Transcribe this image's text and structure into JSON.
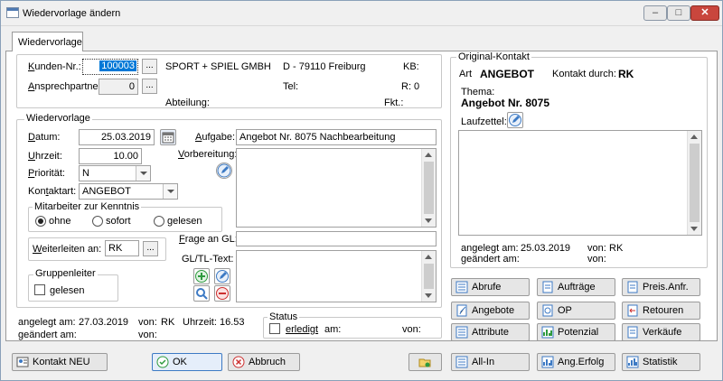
{
  "window": {
    "title": "Wiedervorlage ändern",
    "min": "–",
    "max": "□",
    "close": "✕"
  },
  "tab": "Wiedervorlage",
  "customer": {
    "kunden_label": "Kunden-Nr.:",
    "kunden_nr": "100003",
    "company": "SPORT + SPIEL GMBH",
    "address": "D - 79110 Freiburg",
    "kb_label": "KB:",
    "ansprech_label": "Ansprechpartner:",
    "ansprech_value": "0",
    "tel_label": "Tel:",
    "r_label": "R: 0",
    "abteilung_label": "Abteilung:",
    "fkt_label": "Fkt.:",
    "dots": "..."
  },
  "wv": {
    "legend": "Wiedervorlage",
    "datum_label": "Datum:",
    "datum": "25.03.2019",
    "uhrzeit_label": "Uhrzeit:",
    "uhrzeit": "10.00",
    "prioritaet_label": "Priorität:",
    "prioritaet": "N",
    "kontaktart_label": "Kontaktart:",
    "kontaktart": "ANGEBOT",
    "aufgabe_label": "Aufgabe:",
    "aufgabe": "Angebot Nr. 8075 Nachbearbeitung",
    "vorbereitung_label": "Vorbereitung:",
    "kenntnis_legend": "Mitarbeiter zur Kenntnis",
    "opt_ohne": "ohne",
    "opt_sofort": "sofort",
    "opt_gelesen": "gelesen",
    "weiterleiten_label": "Weiterleiten an:",
    "weiterleiten": "RK",
    "frage_label": "Frage an GL:",
    "gltl_label": "GL/TL-Text:",
    "gruppenleiter_legend": "Gruppenleiter",
    "gelesen_label": "gelesen"
  },
  "original": {
    "legend": "Original-Kontakt",
    "art_label": "Art",
    "art": "ANGEBOT",
    "kontakt_durch_label": "Kontakt durch:",
    "kontakt_durch": "RK",
    "thema_label": "Thema:",
    "thema": "Angebot Nr. 8075",
    "laufzettel_label": "Laufzettel:",
    "angelegt_label": "angelegt am:",
    "angelegt": "25.03.2019",
    "von_label": "von:",
    "angelegt_von": "RK",
    "geaendert_label": "geändert am:",
    "geaendert_von_label": "von:"
  },
  "footer": {
    "angelegt_label": "angelegt am:",
    "angelegt": "27.03.2019",
    "von_label": "von:",
    "von": "RK",
    "uhrzeit_label": "Uhrzeit:",
    "uhrzeit": "16.53",
    "geaendert_label": "geändert am:",
    "geaendert_von_label": "von:",
    "status_legend": "Status",
    "erledigt_label": "erledigt",
    "am_label": "am:",
    "status_von_label": "von:"
  },
  "actions": [
    "Abrufe",
    "Aufträge",
    "Preis.Anfr.",
    "Angebote",
    "OP",
    "Retouren",
    "Attribute",
    "Potenzial",
    "Verkäufe"
  ],
  "bottom": {
    "kontakt_neu": "Kontakt NEU",
    "ok": "OK",
    "abbruch": "Abbruch",
    "allin": "All-In",
    "angerfolg": "Ang.Erfolg",
    "statistik": "Statistik"
  },
  "colors": {
    "accent": "#3d7ac4",
    "green": "#2e9a3e",
    "red": "#cc2f2f",
    "highlight": "#0078d7"
  }
}
